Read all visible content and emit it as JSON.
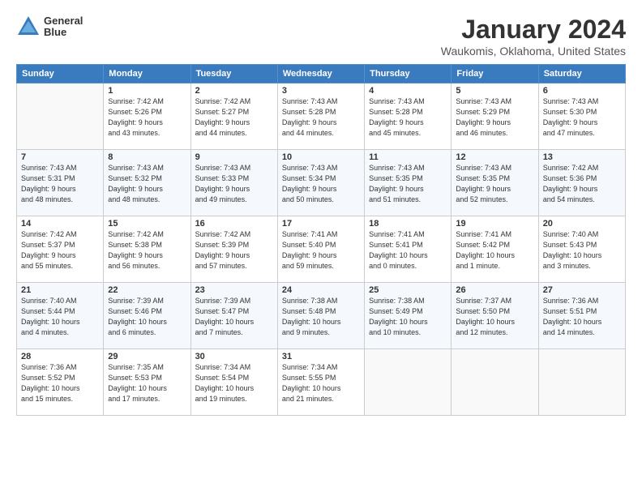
{
  "header": {
    "logo_line1": "General",
    "logo_line2": "Blue",
    "month": "January 2024",
    "location": "Waukomis, Oklahoma, United States"
  },
  "weekdays": [
    "Sunday",
    "Monday",
    "Tuesday",
    "Wednesday",
    "Thursday",
    "Friday",
    "Saturday"
  ],
  "weeks": [
    [
      {
        "day": "",
        "content": ""
      },
      {
        "day": "1",
        "content": "Sunrise: 7:42 AM\nSunset: 5:26 PM\nDaylight: 9 hours\nand 43 minutes."
      },
      {
        "day": "2",
        "content": "Sunrise: 7:42 AM\nSunset: 5:27 PM\nDaylight: 9 hours\nand 44 minutes."
      },
      {
        "day": "3",
        "content": "Sunrise: 7:43 AM\nSunset: 5:28 PM\nDaylight: 9 hours\nand 44 minutes."
      },
      {
        "day": "4",
        "content": "Sunrise: 7:43 AM\nSunset: 5:28 PM\nDaylight: 9 hours\nand 45 minutes."
      },
      {
        "day": "5",
        "content": "Sunrise: 7:43 AM\nSunset: 5:29 PM\nDaylight: 9 hours\nand 46 minutes."
      },
      {
        "day": "6",
        "content": "Sunrise: 7:43 AM\nSunset: 5:30 PM\nDaylight: 9 hours\nand 47 minutes."
      }
    ],
    [
      {
        "day": "7",
        "content": "Sunrise: 7:43 AM\nSunset: 5:31 PM\nDaylight: 9 hours\nand 48 minutes."
      },
      {
        "day": "8",
        "content": "Sunrise: 7:43 AM\nSunset: 5:32 PM\nDaylight: 9 hours\nand 48 minutes."
      },
      {
        "day": "9",
        "content": "Sunrise: 7:43 AM\nSunset: 5:33 PM\nDaylight: 9 hours\nand 49 minutes."
      },
      {
        "day": "10",
        "content": "Sunrise: 7:43 AM\nSunset: 5:34 PM\nDaylight: 9 hours\nand 50 minutes."
      },
      {
        "day": "11",
        "content": "Sunrise: 7:43 AM\nSunset: 5:35 PM\nDaylight: 9 hours\nand 51 minutes."
      },
      {
        "day": "12",
        "content": "Sunrise: 7:43 AM\nSunset: 5:35 PM\nDaylight: 9 hours\nand 52 minutes."
      },
      {
        "day": "13",
        "content": "Sunrise: 7:42 AM\nSunset: 5:36 PM\nDaylight: 9 hours\nand 54 minutes."
      }
    ],
    [
      {
        "day": "14",
        "content": "Sunrise: 7:42 AM\nSunset: 5:37 PM\nDaylight: 9 hours\nand 55 minutes."
      },
      {
        "day": "15",
        "content": "Sunrise: 7:42 AM\nSunset: 5:38 PM\nDaylight: 9 hours\nand 56 minutes."
      },
      {
        "day": "16",
        "content": "Sunrise: 7:42 AM\nSunset: 5:39 PM\nDaylight: 9 hours\nand 57 minutes."
      },
      {
        "day": "17",
        "content": "Sunrise: 7:41 AM\nSunset: 5:40 PM\nDaylight: 9 hours\nand 59 minutes."
      },
      {
        "day": "18",
        "content": "Sunrise: 7:41 AM\nSunset: 5:41 PM\nDaylight: 10 hours\nand 0 minutes."
      },
      {
        "day": "19",
        "content": "Sunrise: 7:41 AM\nSunset: 5:42 PM\nDaylight: 10 hours\nand 1 minute."
      },
      {
        "day": "20",
        "content": "Sunrise: 7:40 AM\nSunset: 5:43 PM\nDaylight: 10 hours\nand 3 minutes."
      }
    ],
    [
      {
        "day": "21",
        "content": "Sunrise: 7:40 AM\nSunset: 5:44 PM\nDaylight: 10 hours\nand 4 minutes."
      },
      {
        "day": "22",
        "content": "Sunrise: 7:39 AM\nSunset: 5:46 PM\nDaylight: 10 hours\nand 6 minutes."
      },
      {
        "day": "23",
        "content": "Sunrise: 7:39 AM\nSunset: 5:47 PM\nDaylight: 10 hours\nand 7 minutes."
      },
      {
        "day": "24",
        "content": "Sunrise: 7:38 AM\nSunset: 5:48 PM\nDaylight: 10 hours\nand 9 minutes."
      },
      {
        "day": "25",
        "content": "Sunrise: 7:38 AM\nSunset: 5:49 PM\nDaylight: 10 hours\nand 10 minutes."
      },
      {
        "day": "26",
        "content": "Sunrise: 7:37 AM\nSunset: 5:50 PM\nDaylight: 10 hours\nand 12 minutes."
      },
      {
        "day": "27",
        "content": "Sunrise: 7:36 AM\nSunset: 5:51 PM\nDaylight: 10 hours\nand 14 minutes."
      }
    ],
    [
      {
        "day": "28",
        "content": "Sunrise: 7:36 AM\nSunset: 5:52 PM\nDaylight: 10 hours\nand 15 minutes."
      },
      {
        "day": "29",
        "content": "Sunrise: 7:35 AM\nSunset: 5:53 PM\nDaylight: 10 hours\nand 17 minutes."
      },
      {
        "day": "30",
        "content": "Sunrise: 7:34 AM\nSunset: 5:54 PM\nDaylight: 10 hours\nand 19 minutes."
      },
      {
        "day": "31",
        "content": "Sunrise: 7:34 AM\nSunset: 5:55 PM\nDaylight: 10 hours\nand 21 minutes."
      },
      {
        "day": "",
        "content": ""
      },
      {
        "day": "",
        "content": ""
      },
      {
        "day": "",
        "content": ""
      }
    ]
  ]
}
